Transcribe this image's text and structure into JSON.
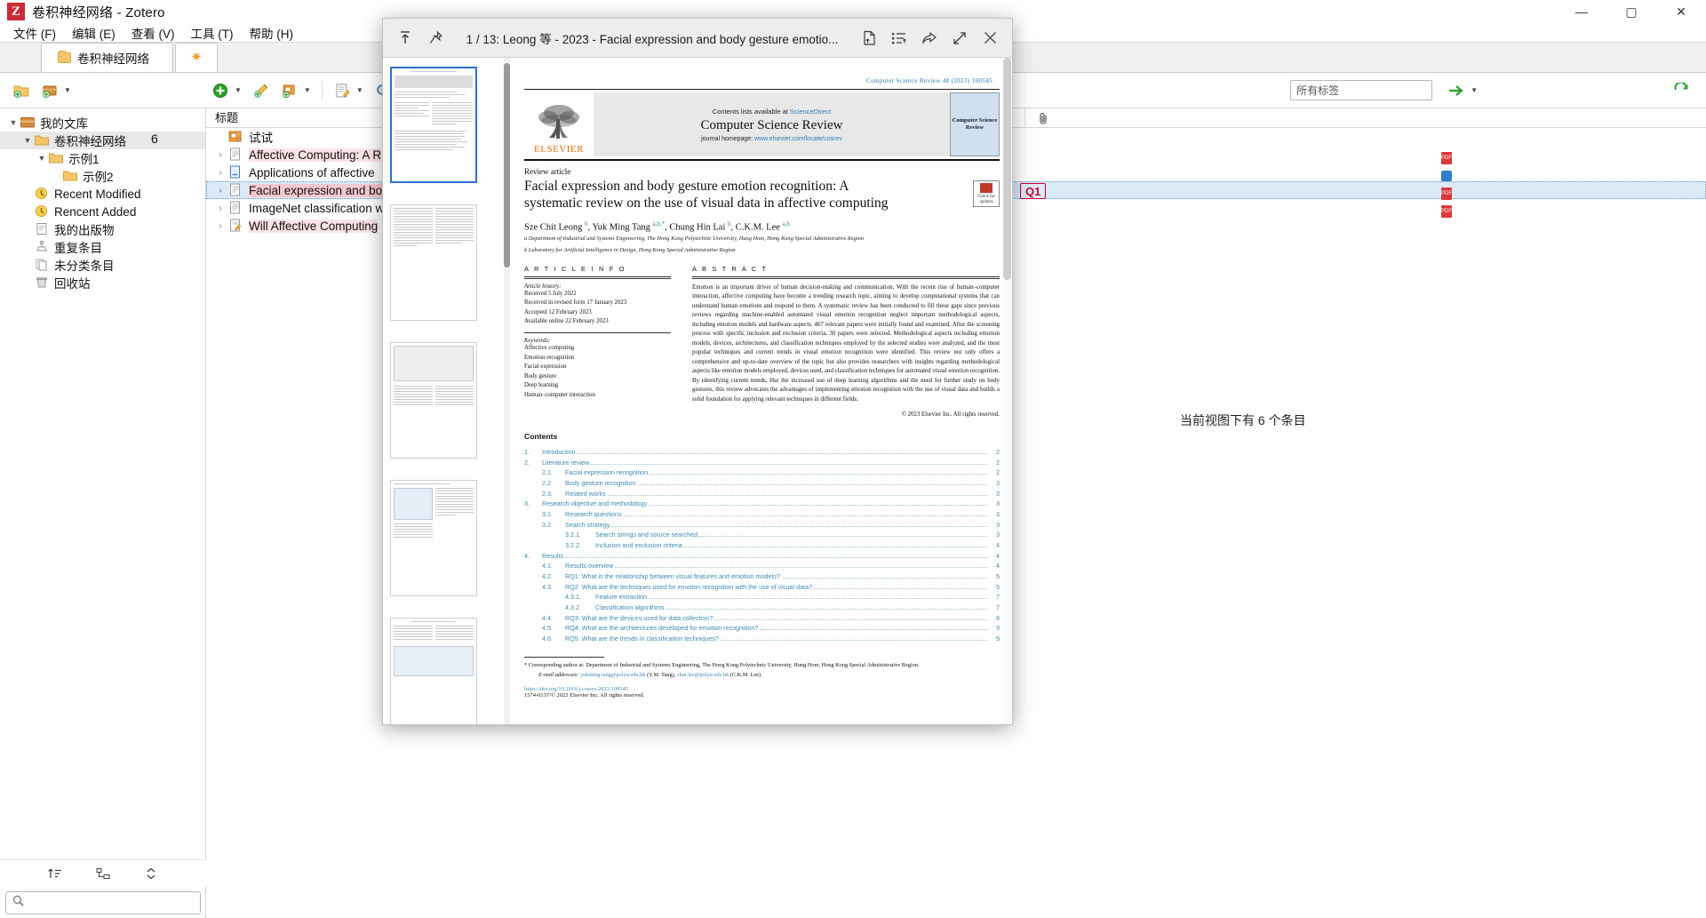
{
  "window": {
    "app_title": "卷积神经网络 - Zotero",
    "logo_letter": "Z",
    "controls": {
      "minimize": "—",
      "maximize": "▢",
      "close": "✕"
    }
  },
  "menubar": {
    "items": [
      {
        "label": "文件 (F)",
        "name": "menu-file"
      },
      {
        "label": "编辑 (E)",
        "name": "menu-edit"
      },
      {
        "label": "查看 (V)",
        "name": "menu-view"
      },
      {
        "label": "工具 (T)",
        "name": "menu-tools"
      },
      {
        "label": "帮助 (H)",
        "name": "menu-help"
      }
    ]
  },
  "tabs": [
    {
      "label": "卷积神经网络",
      "icon": "folder-icon",
      "active": true
    },
    {
      "label": "",
      "icon": "connector-star-icon",
      "active": false
    }
  ],
  "toolbar": {
    "new_collection": "new-collection-icon",
    "new_library": "new-library-icon",
    "new_item": "new-item-icon",
    "add_by_identifier": "magic-wand-icon",
    "add_attachment": "add-attachment-icon",
    "new_note": "new-note-icon",
    "advanced_search": "advanced-search-icon",
    "search_placeholder": "所有标签",
    "sync": "sync-icon",
    "locate": "locate-arrow-icon"
  },
  "collections": {
    "items": [
      {
        "label": "我的文库",
        "indent": 0,
        "icon": "library-icon",
        "twisty": "▼",
        "selected": false
      },
      {
        "label": "卷积神经网络",
        "indent": 1,
        "icon": "folder-icon",
        "twisty": "▼",
        "selected": true
      },
      {
        "label": "示例1",
        "indent": 2,
        "icon": "folder-icon",
        "twisty": "▼",
        "selected": false
      },
      {
        "label": "示例2",
        "indent": 3,
        "icon": "folder-icon",
        "twisty": "",
        "selected": false
      },
      {
        "label": "Recent Modified",
        "indent": 1,
        "icon": "clock-icon",
        "twisty": "",
        "selected": false
      },
      {
        "label": "Rencent Added",
        "indent": 1,
        "icon": "clock-icon",
        "twisty": "",
        "selected": false
      },
      {
        "label": "我的出版物",
        "indent": 1,
        "icon": "document-icon",
        "twisty": "",
        "selected": false
      },
      {
        "label": "重复条目",
        "indent": 1,
        "icon": "duplicates-icon",
        "twisty": "",
        "selected": false
      },
      {
        "label": "未分类条目",
        "indent": 1,
        "icon": "unfiled-icon",
        "twisty": "",
        "selected": false
      },
      {
        "label": "回收站",
        "indent": 1,
        "icon": "trash-icon",
        "twisty": "",
        "selected": false
      }
    ],
    "bottom_tools": [
      "sort-icon",
      "collapse-tree-icon",
      "expand-collapse-icon"
    ],
    "search_icon": "search-icon"
  },
  "items": {
    "columns": {
      "title": "标题",
      "attachment": "paperclip-icon"
    },
    "row_count_label": "6",
    "rows": [
      {
        "title": "试试",
        "icon": "snapshot-icon",
        "twisty": "",
        "selected": false,
        "highlight": ""
      },
      {
        "title": "Affective Computing: A R",
        "icon": "document-icon",
        "twisty": "›",
        "selected": false,
        "highlight": "Affective"
      },
      {
        "title": "Applications of affective",
        "icon": "blue-document-icon",
        "twisty": "›",
        "selected": false,
        "highlight": ""
      },
      {
        "title": "Facial expression and bo",
        "icon": "document-icon",
        "twisty": "›",
        "selected": true,
        "highlight": "cial express"
      },
      {
        "title": "ImageNet classification w",
        "icon": "document-icon",
        "twisty": "›",
        "selected": false,
        "highlight": ""
      },
      {
        "title": "Will Affective Computing",
        "icon": "note-document-icon",
        "twisty": "›",
        "selected": false,
        "highlight": ""
      }
    ],
    "q1_badge": "Q1",
    "view_count_text": "当前视图下有 6 个条目"
  },
  "reader": {
    "toolbar": {
      "back_to_top": "arrow-up-icon",
      "pin": "pin-icon",
      "title": "1 / 13: Leong 等 - 2023 - Facial expression and body gesture emotio...",
      "add_note": "add-note-icon",
      "item_pane": "item-list-icon",
      "share": "share-icon",
      "expand": "expand-icon",
      "close": "close-icon"
    },
    "thumbnails": {
      "count": 5,
      "active_index": 0
    }
  },
  "pdf": {
    "journal_header": "Computer Science Review 48 (2023) 100545",
    "masthead": {
      "contents_line_prefix": "Contents lists available at ",
      "contents_link": "ScienceDirect",
      "journal_name": "Computer Science Review",
      "homepage_prefix": "journal homepage: ",
      "homepage_link": "www.elsevier.com/locate/cosrev",
      "publisher": "ELSEVIER",
      "cover_text": "Computer Science Review"
    },
    "article_type": "Review article",
    "title": "Facial expression and body gesture emotion recognition: A systematic review on the use of visual data in affective computing",
    "crossmark": "Check for updates",
    "authors_html": "Sze Chit Leong <sup>b</sup>, Yuk Ming Tang <sup>a,b,*</sup>, Chung Hin Lai <sup>b</sup>, C.K.M. Lee <sup>a,b</sup>",
    "affiliations": [
      "a Department of Industrial and Systems Engineering, The Hong Kong Polytechnic University, Hung Hom, Hong Kong Special Administrative Region",
      "b Laboratory for Artificial Intelligence in Design, Hong Kong Special Administrative Region"
    ],
    "article_info": {
      "heading": "A R T I C L E   I N F O",
      "history_label": "Article history:",
      "history": [
        "Received 5 July 2022",
        "Received in revised form 17 January 2023",
        "Accepted 12 February 2023",
        "Available online 22 February 2023"
      ],
      "keywords_label": "Keywords:",
      "keywords": [
        "Affective computing",
        "Emotion recognition",
        "Facial expression",
        "Body gesture",
        "Deep learning",
        "Human–computer interaction"
      ]
    },
    "abstract": {
      "heading": "A B S T R A C T",
      "text": "Emotion is an important driver of human decision-making and communication. With the recent rise of human–computer interaction, affective computing have become a trending research topic, aiming to develop computational systems that can understand human emotions and respond to them. A systematic review has been conducted to fill these gaps since previous reviews regarding machine-enabled automated visual emotion recognition neglect important methodological aspects, including emotion models and hardware aspects. 467 relevant papers were initially found and examined. After the screening process with specific inclusion and exclusion criteria, 30 papers were selected. Methodological aspects including emotion models, devices, architectures, and classification techniques employed by the selected studies were analyzed, and the most popular techniques and current trends in visual emotion recognition were identified. This review not only offers a comprehensive and up-to-date overview of the topic but also provides researchers with insights regarding methodological aspects like emotion models employed, devices used, and classification techniques for automated visual emotion recognition. By identifying current trends, like the increased use of deep learning algorithms and the need for further study on body gestures, this review advocates the advantages of implementing emotion recognition with the use of visual data and builds a solid foundation for applying relevant techniques in different fields.",
      "copyright": "© 2023 Elsevier Inc. All rights reserved."
    },
    "contents_heading": "Contents",
    "toc": [
      {
        "num": "1.",
        "text": "Introduction",
        "page": "2",
        "level": 0
      },
      {
        "num": "2.",
        "text": "Literature review",
        "page": "2",
        "level": 0
      },
      {
        "num": "2.1.",
        "text": "Facial expression recognition",
        "page": "2",
        "level": 1
      },
      {
        "num": "2.2.",
        "text": "Body gesture recognition",
        "page": "3",
        "level": 1
      },
      {
        "num": "2.3.",
        "text": "Related works",
        "page": "3",
        "level": 1
      },
      {
        "num": "3.",
        "text": "Research objective and methodology",
        "page": "3",
        "level": 0
      },
      {
        "num": "3.1.",
        "text": "Research questions",
        "page": "3",
        "level": 1
      },
      {
        "num": "3.2.",
        "text": "Search strategy",
        "page": "3",
        "level": 1
      },
      {
        "num": "3.2.1.",
        "text": "Search strings and source searched",
        "page": "3",
        "level": 2
      },
      {
        "num": "3.2.2.",
        "text": "Inclusion and exclusion criteria",
        "page": "4",
        "level": 2
      },
      {
        "num": "4.",
        "text": "Results",
        "page": "4",
        "level": 0
      },
      {
        "num": "4.1.",
        "text": "Results overview",
        "page": "4",
        "level": 1
      },
      {
        "num": "4.2.",
        "text": "RQ1: What is the relationship between visual features and emotion models?",
        "page": "5",
        "level": 1
      },
      {
        "num": "4.3.",
        "text": "RQ2: What are the techniques used for emotion recognition with the use of visual data?",
        "page": "5",
        "level": 1
      },
      {
        "num": "4.3.1.",
        "text": "Feature extraction",
        "page": "7",
        "level": 2
      },
      {
        "num": "4.3.2.",
        "text": "Classification algorithms",
        "page": "7",
        "level": 2
      },
      {
        "num": "4.4.",
        "text": "RQ3: What are the devices used for data collection?",
        "page": "8",
        "level": 1
      },
      {
        "num": "4.5.",
        "text": "RQ4: What are the architectures developed for emotion recognition?",
        "page": "9",
        "level": 1
      },
      {
        "num": "4.6.",
        "text": "RQ5: What are the trends in classification techniques?",
        "page": "9",
        "level": 1
      }
    ],
    "footnotes": {
      "corresponding": "* Corresponding author at: Department of Industrial and Systems Engineering, The Hong Kong Polytechnic University, Hung Hom, Hong Kong Special Administrative Region.",
      "email_label": "E-mail addresses:",
      "email1": "yukming.tang@polyu.edu.hk",
      "email1_owner": "(Y.M. Tang),",
      "email2": "ckm.lee@polyu.edu.hk",
      "email2_owner": "(C.K.M. Lee).",
      "doi": "https://doi.org/10.1016/j.cosrev.2023.100545",
      "issn": "1574-0137/© 2023 Elsevier Inc. All rights reserved."
    }
  },
  "colors": {
    "accent_blue": "#2f7db5",
    "elsevier_orange": "#e86c10",
    "selection_blue": "#dceaf7",
    "highlight_pink": "#f7c8cf",
    "zotero_red": "#cc2936"
  }
}
